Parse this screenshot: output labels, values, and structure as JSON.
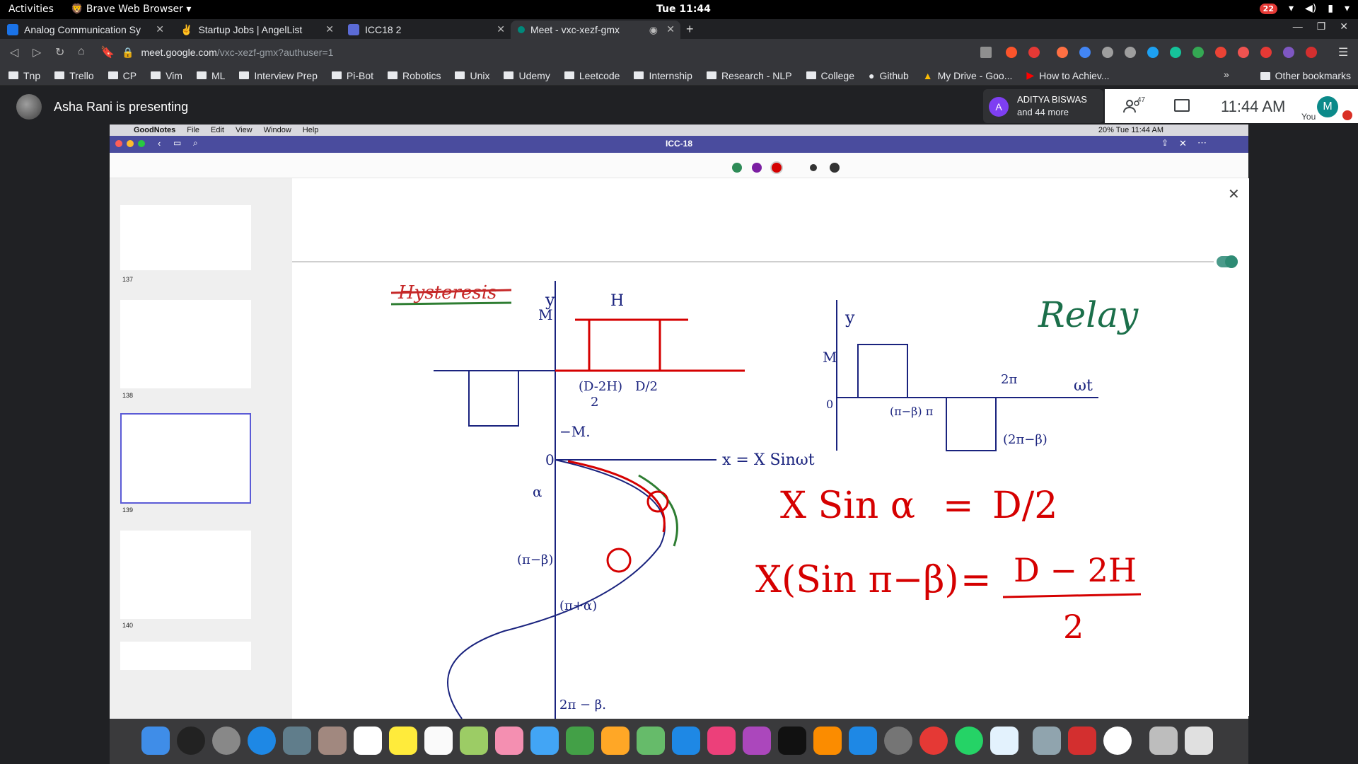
{
  "system": {
    "activities": "Activities",
    "app_menu": "Brave Web Browser",
    "clock": "Tue 11:44",
    "notif_count": "22"
  },
  "tabs": [
    {
      "title": "Analog Communication Sy",
      "favicon_color": "#1a73e8"
    },
    {
      "title": "Startup Jobs | AngelList",
      "favicon_color": "#ffffff"
    },
    {
      "title": "ICC18 2",
      "favicon_color": "#5b6bd6"
    },
    {
      "title": "Meet - vxc-xezf-gmx",
      "favicon_color": "#00897b"
    }
  ],
  "address": {
    "host": "meet.google.com",
    "path": "/vxc-xezf-gmx?authuser=1"
  },
  "bookmarks": [
    "Tnp",
    "Trello",
    "CP",
    "Vim",
    "ML",
    "Interview Prep",
    "Pi-Bot",
    "Robotics",
    "Unix",
    "Udemy",
    "Leetcode",
    "Internship",
    "Research - NLP",
    "College",
    "Github",
    "My Drive - Goo...",
    "How to Achiev..."
  ],
  "other_bookmarks": "Other bookmarks",
  "meet": {
    "presenting_text": "Asha Rani is presenting",
    "participant_initial": "A",
    "participant_name": "ADITYA BISWAS",
    "participant_more": "and 44 more",
    "people_count": "47",
    "time": "11:44 AM",
    "you_initial": "M",
    "you_label": "You"
  },
  "mac": {
    "app": "GoodNotes",
    "menus": [
      "File",
      "Edit",
      "View",
      "Window",
      "Help"
    ],
    "status": "20%   Tue 11:44 AM"
  },
  "goodnotes": {
    "doc_title": "ICC-18",
    "pages": [
      "137",
      "138",
      "139",
      "140"
    ]
  },
  "notes": {
    "hysteresis": "Hysteresis",
    "relay": "Relay",
    "eq1_lhs": "X Sin α",
    "eq1_rhs": "D/2",
    "eq2_lhs": "X(Sin π−β)",
    "eq2_rhs_num": "D − 2H",
    "eq2_rhs_den": "2",
    "input_label": "x = X Sinωt",
    "wt_label": "ωt",
    "two_pi": "2π",
    "pi_minus_beta": "(π−β) π",
    "two_pi_minus_beta": "(2π−β)",
    "y_label": "y",
    "H_label": "H",
    "M_label": "M",
    "minus_M": "−M.",
    "D_minus_2H": "(D-2H)",
    "D_over_2": "D/2",
    "two": "2",
    "alpha": "α",
    "pi_minus_beta_short": "(π−β)",
    "pi_plus_alpha": "(π+α)",
    "two_pi_minus_B": "2π − β.",
    "zero": "0"
  }
}
